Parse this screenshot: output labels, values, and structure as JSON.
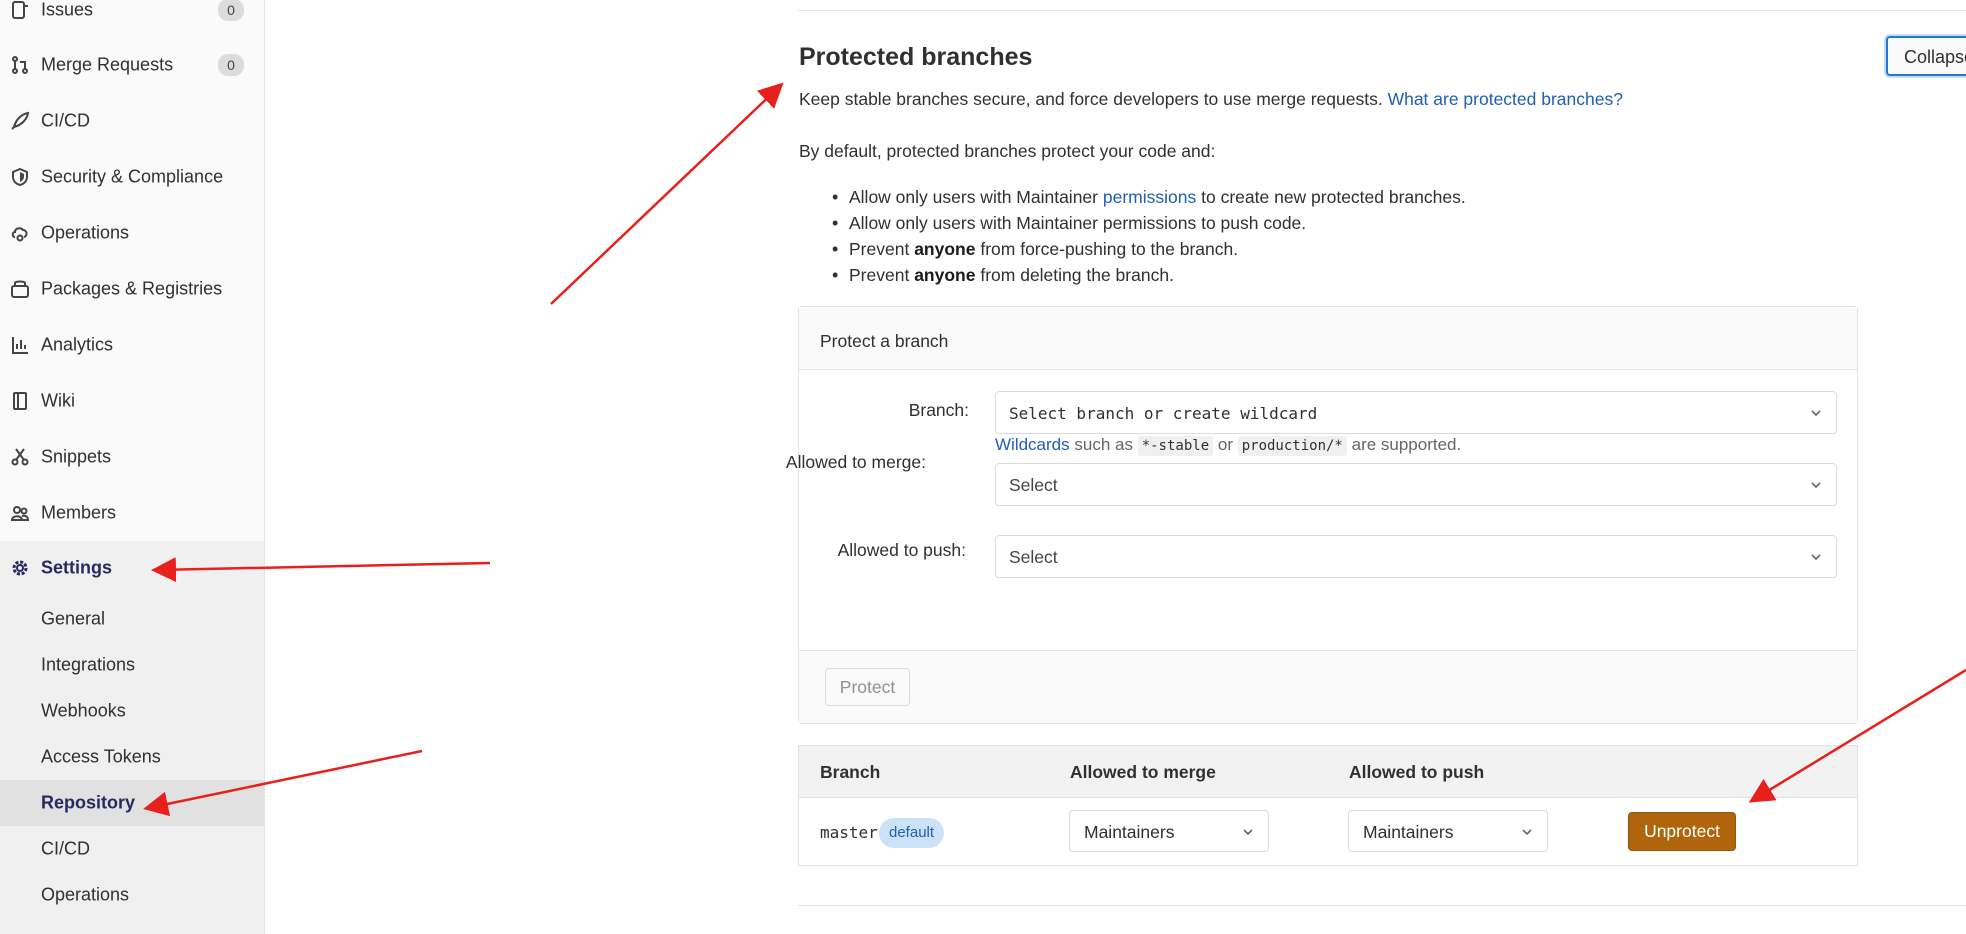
{
  "sidebar": {
    "items": [
      {
        "label": "Issues",
        "icon": "issues-icon",
        "count": "0"
      },
      {
        "label": "Merge Requests",
        "icon": "merge-request-icon",
        "count": "0"
      },
      {
        "label": "CI/CD",
        "icon": "rocket-icon"
      },
      {
        "label": "Security & Compliance",
        "icon": "shield-icon"
      },
      {
        "label": "Operations",
        "icon": "cloud-gear-icon"
      },
      {
        "label": "Packages & Registries",
        "icon": "package-icon"
      },
      {
        "label": "Analytics",
        "icon": "chart-icon"
      },
      {
        "label": "Wiki",
        "icon": "book-icon"
      },
      {
        "label": "Snippets",
        "icon": "scissors-icon"
      },
      {
        "label": "Members",
        "icon": "users-icon"
      },
      {
        "label": "Settings",
        "icon": "gear-icon"
      }
    ],
    "settings_sub": [
      {
        "label": "General"
      },
      {
        "label": "Integrations"
      },
      {
        "label": "Webhooks"
      },
      {
        "label": "Access Tokens"
      },
      {
        "label": "Repository",
        "active": true
      },
      {
        "label": "CI/CD"
      },
      {
        "label": "Operations"
      }
    ]
  },
  "main": {
    "title": "Protected branches",
    "collapse_label": "Collapse",
    "lead_text": "Keep stable branches secure, and force developers to use merge requests.",
    "lead_link": "What are protected branches?",
    "intro": "By default, protected branches protect your code and:",
    "rules": {
      "r1_pre": "Allow only users with Maintainer",
      "r1_link": "permissions",
      "r1_post": "to create new protected branches.",
      "r2": "Allow only users with Maintainer permissions to push code.",
      "r3_pre": "Prevent",
      "r3_bold": "anyone",
      "r3_post": "from force-pushing to the branch.",
      "r4_pre": "Prevent",
      "r4_bold": "anyone",
      "r4_post": "from deleting the branch."
    }
  },
  "protect_form": {
    "header": "Protect a branch",
    "branch_label": "Branch:",
    "branch_placeholder": "Select branch or create wildcard",
    "hint_link": "Wildcards",
    "hint_mid": "such as",
    "hint_code1": "*-stable",
    "hint_or": "or",
    "hint_code2": "production/*",
    "hint_end": "are supported.",
    "merge_label": "Allowed to merge:",
    "merge_value": "Select",
    "push_label": "Allowed to push:",
    "push_value": "Select",
    "protect_button": "Protect"
  },
  "table": {
    "headers": [
      "Branch",
      "Allowed to merge",
      "Allowed to push"
    ],
    "rows": [
      {
        "branch": "master",
        "badge": "default",
        "merge": "Maintainers",
        "push": "Maintainers",
        "action": "Unprotect"
      }
    ]
  },
  "colors": {
    "link": "#1f5fb5",
    "active_nav": "#292961",
    "unprotect": "#b0640b",
    "annotation_arrow": "#e8201c"
  }
}
